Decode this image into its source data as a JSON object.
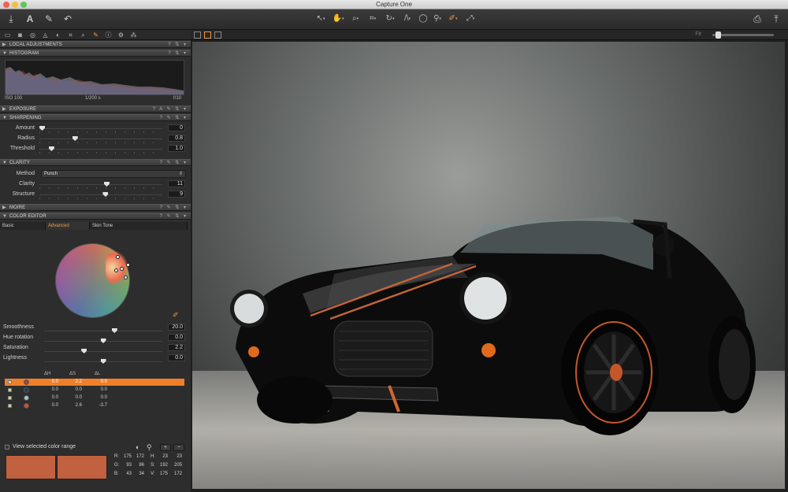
{
  "app_title": "Capture One",
  "histogram": {
    "iso": "ISO 100",
    "shutter": "1/200 s",
    "aperture": "f/10"
  },
  "sections": {
    "local_adjustments": "LOCAL ADJUSTMENTS",
    "histogram": "HISTOGRAM",
    "exposure": "EXPOSURE",
    "sharpening": "SHARPENING",
    "clarity": "CLARITY",
    "moire": "MOIRE",
    "color_editor": "COLOR EDITOR"
  },
  "sharpening": {
    "amount": {
      "label": "Amount",
      "value": "0",
      "level": 0.0
    },
    "radius": {
      "label": "Radius",
      "value": "0.8",
      "level": 0.28
    },
    "threshold": {
      "label": "Threshold",
      "value": "1.0",
      "level": 0.08
    }
  },
  "clarity": {
    "method_label": "Method",
    "method_value": "Punch",
    "clarity": {
      "label": "Clarity",
      "value": "11",
      "level": 0.55
    },
    "structure": {
      "label": "Structure",
      "value": "9",
      "level": 0.54
    }
  },
  "color_editor": {
    "tabs": [
      "Basic",
      "Advanced",
      "Skin Tone"
    ],
    "active_tab": "Advanced",
    "smoothness": {
      "label": "Smoothness",
      "value": "20.0",
      "level": 0.6
    },
    "hue_rotation": {
      "label": "Hue rotation",
      "value": "0.0",
      "level": 0.5
    },
    "saturation": {
      "label": "Saturation",
      "value": "2.2",
      "level": 0.33
    },
    "lightness": {
      "label": "Lightness",
      "value": "0.0",
      "level": 0.5
    },
    "table_headers": [
      "ΔH",
      "ΔS",
      "ΔL"
    ],
    "rows": [
      {
        "color": "#a04a2e",
        "dh": "0.0",
        "ds": "2.2",
        "dl": "0.0",
        "selected": true
      },
      {
        "color": "#2a3a4a",
        "dh": "0.0",
        "ds": "0.0",
        "dl": "0.0",
        "selected": false
      },
      {
        "color": "#a8c6cc",
        "dh": "0.0",
        "ds": "0.0",
        "dl": "0.0",
        "selected": false
      },
      {
        "color": "#c9552e",
        "dh": "0.0",
        "ds": "2.6",
        "dl": "-3.7",
        "selected": false
      }
    ],
    "view_selected_label": "View selected color range",
    "swatch_left": "#c2613f",
    "swatch_right": "#c2613f",
    "rgb": {
      "r": {
        "label": "R:",
        "a": "175",
        "b": "172"
      },
      "g": {
        "label": "G:",
        "a": "93",
        "b": "86"
      },
      "b": {
        "label": "B:",
        "a": "43",
        "b": "34"
      },
      "h": {
        "label": "H:",
        "a": "23",
        "b": "23"
      },
      "s": {
        "label": "S:",
        "a": "192",
        "b": "205"
      },
      "v": {
        "label": "V:",
        "a": "175",
        "b": "172"
      }
    }
  },
  "viewer": {
    "fit_label": "Fit"
  },
  "colors": {
    "accent": "#f39a3a",
    "panel": "#2d2d2d"
  }
}
